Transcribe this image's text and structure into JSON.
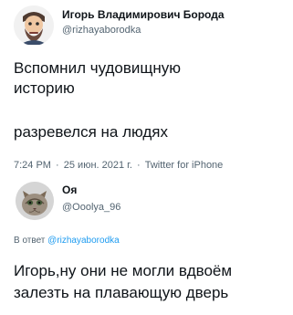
{
  "tweet": {
    "author": {
      "display_name": "Игорь Владимирович Борода",
      "handle": "@rizhayaborodka",
      "avatar": "avatar-illustrated-man"
    },
    "text_lines": [
      "Вспомнил чудовищную",
      "историю",
      "разревелся на людях"
    ],
    "meta": {
      "time": "7:24 PM",
      "separator": "·",
      "date": "25 июн. 2021 г.",
      "source": "Twitter for iPhone"
    }
  },
  "reply": {
    "author": {
      "display_name": "Оя",
      "handle": "@Ooolya_96",
      "avatar": "avatar-cat"
    },
    "reply_to_prefix": "В ответ",
    "reply_to_handle": "@rizhayaborodka",
    "text_lines": [
      "Игорь,ну они не могли вдвоём",
      "залезть на плавающую дверь"
    ]
  },
  "colors": {
    "text": "#0f1419",
    "secondary": "#536471",
    "link": "#1d9bf0",
    "background": "#ffffff"
  }
}
